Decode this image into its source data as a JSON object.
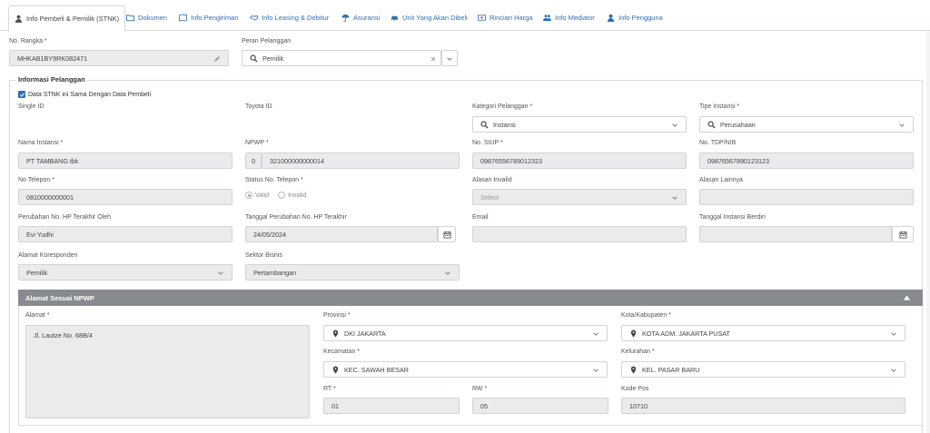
{
  "tabs": [
    {
      "label": "Info Pembeli & Pemilik (STNK)",
      "icon": "user-icon"
    },
    {
      "label": "Dokumen",
      "icon": "folder-icon"
    },
    {
      "label": "Info Pengiriman",
      "icon": "map-icon"
    },
    {
      "label": "Info Leasing & Debitur",
      "icon": "handshake-icon"
    },
    {
      "label": "Asuransi",
      "icon": "umbrella-icon"
    },
    {
      "label": "Unit Yang Akan Dibeli",
      "icon": "car-icon"
    },
    {
      "label": "Rincian Harga",
      "icon": "money-icon"
    },
    {
      "label": "Info Mediator",
      "icon": "users-icon"
    },
    {
      "label": "Info Pengguna",
      "icon": "user-icon"
    }
  ],
  "top": {
    "no_rangka_label": "No. Rangka *",
    "no_rangka_value": "MHKAB1BY9RK082471",
    "peran_label": "Peran Pelanggan",
    "peran_value": "Pemilik"
  },
  "info": {
    "legend": "Informasi Pelanggan",
    "same_as_buyer_label": "Data STNK ini Sama Dengan Data Pembeli",
    "single_id_label": "Single ID",
    "toyota_id_label": "Toyota ID",
    "kategori_label": "Kategori Pelanggan *",
    "kategori_value": "Instansi",
    "tipe_label": "Tipe Instansi *",
    "tipe_value": "Perusahaan",
    "nama_label": "Nama Instansi *",
    "nama_value": "PT TAMBANG tbk",
    "npwp_label": "NPWP *",
    "npwp_prefix": "0",
    "npwp_value": "321000000000014",
    "siup_label": "No. SIUP *",
    "siup_value": "09876556789012323",
    "tdp_label": "No. TDP/NIB",
    "tdp_value": "09876567890123123",
    "telepon_label": "No Telepon *",
    "telepon_value": "0810000000001",
    "status_label": "Status No. Telepon *",
    "status_valid": "Valid",
    "status_invalid": "Invalid",
    "alasan_label": "Alasan Invalid",
    "alasan_placeholder": "Select",
    "alasan_lain_label": "Alasan Lainnya",
    "perubahan_oleh_label": "Perubahan No. HP Terakhir Oleh",
    "perubahan_oleh_value": "Evi Yudhi",
    "tgl_perubahan_label": "Tanggal Perubahan No. HP Terakhir",
    "tgl_perubahan_value": "24/05/2024",
    "email_label": "Email",
    "tgl_berdiri_label": "Tanggal Instansi Berdiri",
    "koresponden_label": "Alamat Koresponden",
    "koresponden_value": "Pemilik",
    "sektor_label": "Sektor Bisnis",
    "sektor_value": "Pertambangan"
  },
  "alamat": {
    "title": "Alamat Sesuai NPWP",
    "alamat_label": "Alamat *",
    "alamat_value": "Jl. Lautze No. 68B/4",
    "provinsi_label": "Provinsi *",
    "provinsi_value": "DKI JAKARTA",
    "kota_label": "Kota/Kabupaten *",
    "kota_value": "KOTA ADM. JAKARTA PUSAT",
    "kecamatan_label": "Kecamatan *",
    "kecamatan_value": "KEC. SAWAH BESAR",
    "kelurahan_label": "Kelurahan *",
    "kelurahan_value": "KEL. PASAR BARU",
    "rt_label": "RT *",
    "rt_value": "01",
    "rw_label": "RW *",
    "rw_value": "05",
    "kodepos_label": "Kode Pos",
    "kodepos_value": "10710"
  },
  "colors": {
    "accent": "#2c6fb7",
    "panel_header": "#878b90",
    "field_disabled": "#e9ebed"
  }
}
